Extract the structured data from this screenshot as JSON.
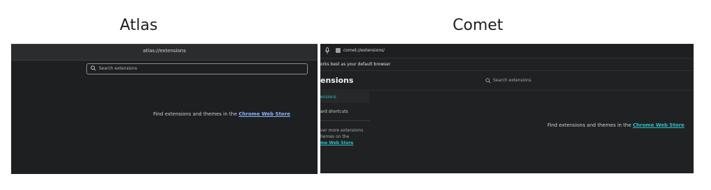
{
  "atlas": {
    "caption": "Atlas",
    "url": "atlas://extensions",
    "search_placeholder": "Search extensions",
    "find_text": "Find extensions and themes in the ",
    "store_link": "Chrome Web Store",
    "colors": {
      "link": "#8ab4f8",
      "background": "#1e1f21"
    }
  },
  "comet": {
    "caption": "Comet",
    "url": "comet://extensions/",
    "banner": "orks best as your default browser",
    "page_title": "ensions",
    "search_placeholder": "Search extensions",
    "sidebar": {
      "active_item": "ensions",
      "item": "ard shortcuts",
      "discover_line1": "ver more extensions",
      "discover_line2": "hemes on the",
      "discover_link": "me Web Store"
    },
    "find_text": "Find extensions and themes in the ",
    "store_link": "Chrome Web Store",
    "colors": {
      "link": "#2bc0c8",
      "background": "#202123"
    }
  }
}
